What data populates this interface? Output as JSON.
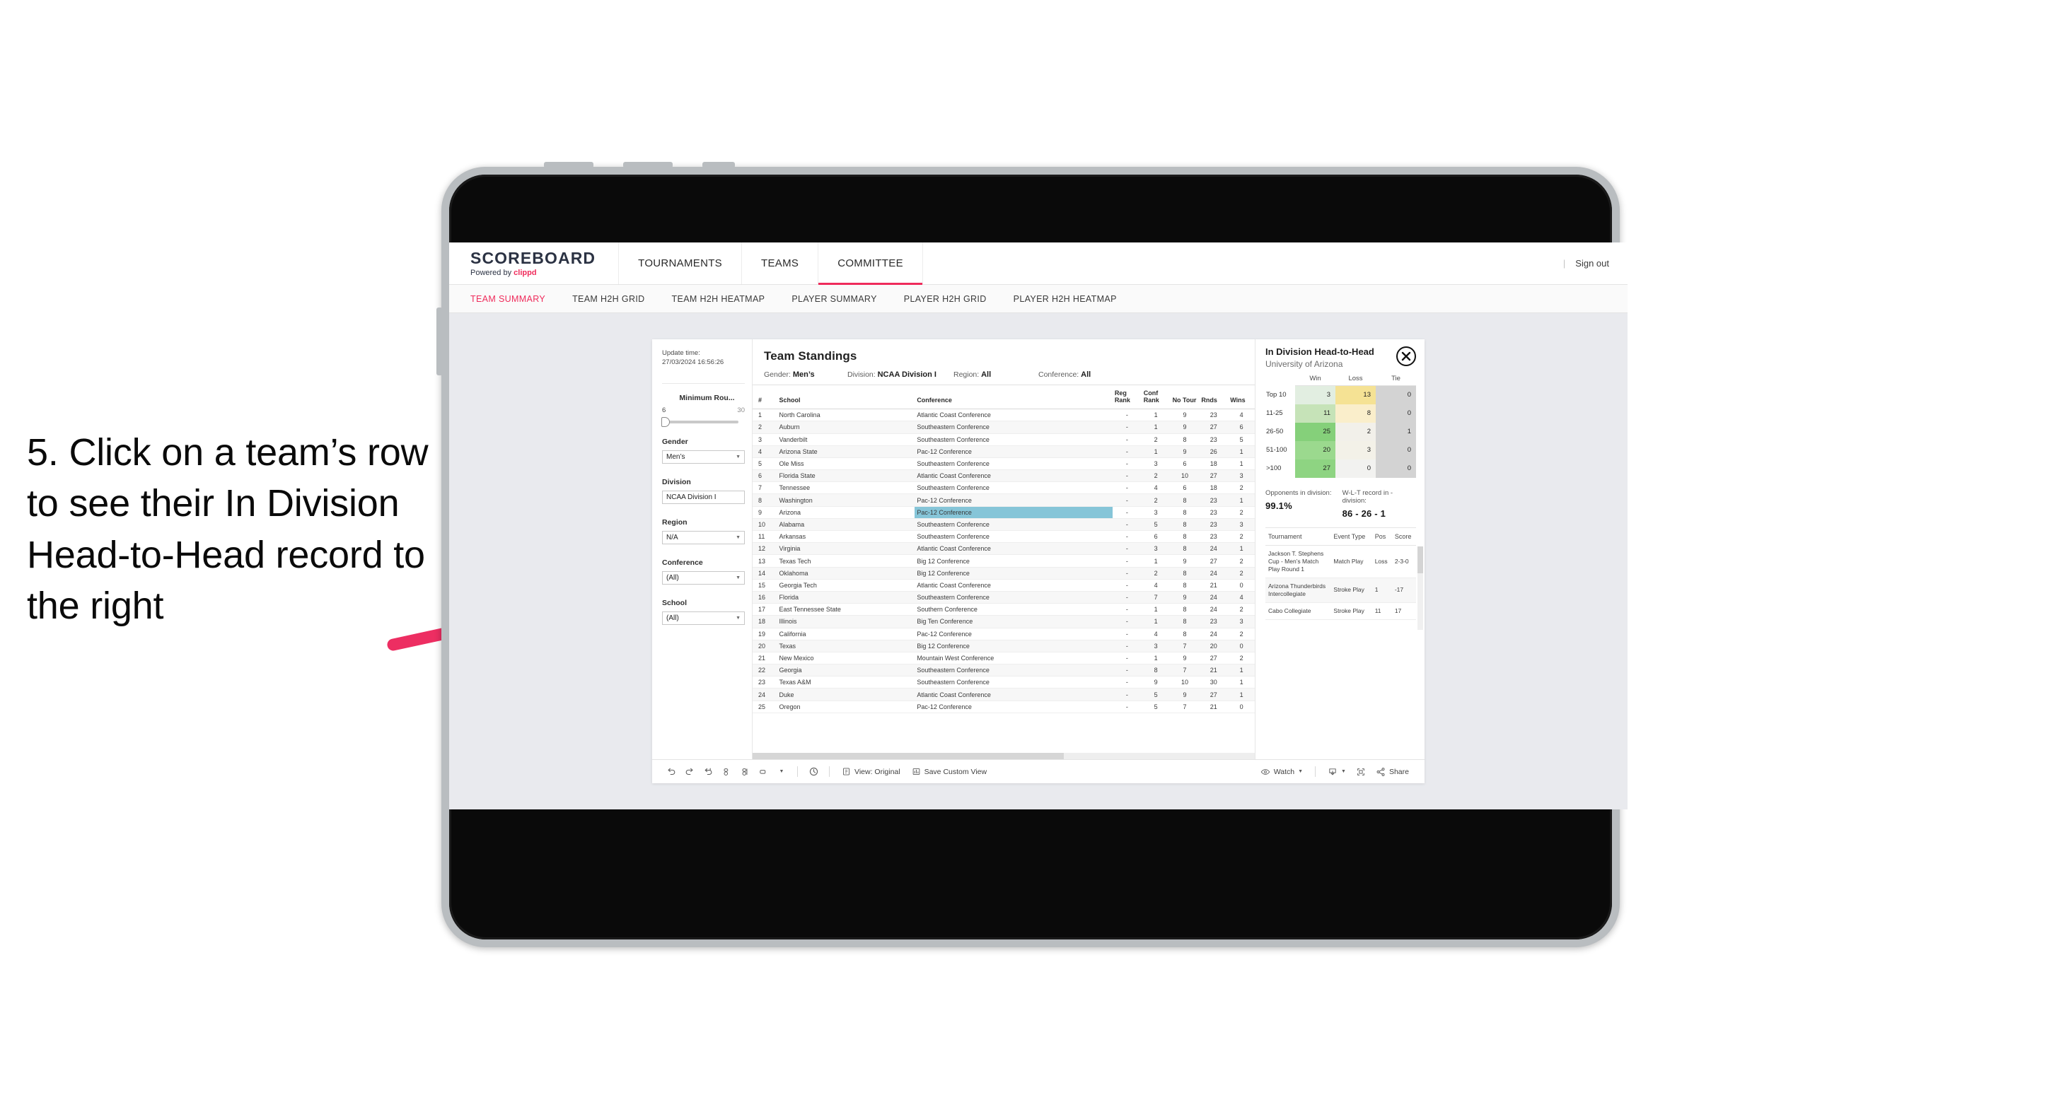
{
  "annotation": {
    "text": "5. Click on a team’s row to see their In Division Head-to-Head record to the right",
    "arrow_color": "#ed2e62"
  },
  "brand": {
    "title": "SCOREBOARD",
    "powered_prefix": "Powered by ",
    "powered_name": "clippd"
  },
  "topnav": {
    "items": [
      {
        "label": "TOURNAMENTS",
        "active": false
      },
      {
        "label": "TEAMS",
        "active": false
      },
      {
        "label": "COMMITTEE",
        "active": true
      }
    ],
    "sign_out": "Sign out",
    "divider": "|"
  },
  "subnav": {
    "items": [
      {
        "label": "TEAM SUMMARY",
        "active": true
      },
      {
        "label": "TEAM H2H GRID",
        "active": false
      },
      {
        "label": "TEAM H2H HEATMAP",
        "active": false
      },
      {
        "label": "PLAYER SUMMARY",
        "active": false
      },
      {
        "label": "PLAYER H2H GRID",
        "active": false
      },
      {
        "label": "PLAYER H2H HEATMAP",
        "active": false
      }
    ]
  },
  "filters": {
    "update_label": "Update time:",
    "update_value": "27/03/2024 16:56:26",
    "min_rounds": {
      "title": "Minimum Rou...",
      "min": "6",
      "max": "30",
      "value": 6
    },
    "gender": {
      "label": "Gender",
      "value": "Men’s"
    },
    "division": {
      "label": "Division",
      "value": "NCAA Division I"
    },
    "region": {
      "label": "Region",
      "value": "N/A"
    },
    "conference": {
      "label": "Conference",
      "value": "(All)"
    },
    "school": {
      "label": "School",
      "value": "(All)"
    }
  },
  "standings": {
    "title": "Team Standings",
    "meta": [
      {
        "label": "Gender: ",
        "value": "Men’s"
      },
      {
        "label": "Division: ",
        "value": "NCAA Division I"
      },
      {
        "label": "Region: ",
        "value": "All"
      },
      {
        "label": "Conference: ",
        "value": "All"
      }
    ],
    "columns": [
      "#",
      "School",
      "Conference",
      "Reg Rank",
      "Conf Rank",
      "No Tour",
      "Rnds",
      "Wins"
    ],
    "selected_row_index": 9,
    "rows": [
      {
        "n": "1",
        "school": "North Carolina",
        "conf": "Atlantic Coast Conference",
        "reg": "-",
        "cr": "1",
        "nt": "9",
        "rnds": "23",
        "wins": "4"
      },
      {
        "n": "2",
        "school": "Auburn",
        "conf": "Southeastern Conference",
        "reg": "-",
        "cr": "1",
        "nt": "9",
        "rnds": "27",
        "wins": "6"
      },
      {
        "n": "3",
        "school": "Vanderbilt",
        "conf": "Southeastern Conference",
        "reg": "-",
        "cr": "2",
        "nt": "8",
        "rnds": "23",
        "wins": "5"
      },
      {
        "n": "4",
        "school": "Arizona State",
        "conf": "Pac-12 Conference",
        "reg": "-",
        "cr": "1",
        "nt": "9",
        "rnds": "26",
        "wins": "1"
      },
      {
        "n": "5",
        "school": "Ole Miss",
        "conf": "Southeastern Conference",
        "reg": "-",
        "cr": "3",
        "nt": "6",
        "rnds": "18",
        "wins": "1"
      },
      {
        "n": "6",
        "school": "Florida State",
        "conf": "Atlantic Coast Conference",
        "reg": "-",
        "cr": "2",
        "nt": "10",
        "rnds": "27",
        "wins": "3"
      },
      {
        "n": "7",
        "school": "Tennessee",
        "conf": "Southeastern Conference",
        "reg": "-",
        "cr": "4",
        "nt": "6",
        "rnds": "18",
        "wins": "2"
      },
      {
        "n": "8",
        "school": "Washington",
        "conf": "Pac-12 Conference",
        "reg": "-",
        "cr": "2",
        "nt": "8",
        "rnds": "23",
        "wins": "1"
      },
      {
        "n": "9",
        "school": "Arizona",
        "conf": "Pac-12 Conference",
        "reg": "-",
        "cr": "3",
        "nt": "8",
        "rnds": "23",
        "wins": "2"
      },
      {
        "n": "10",
        "school": "Alabama",
        "conf": "Southeastern Conference",
        "reg": "-",
        "cr": "5",
        "nt": "8",
        "rnds": "23",
        "wins": "3"
      },
      {
        "n": "11",
        "school": "Arkansas",
        "conf": "Southeastern Conference",
        "reg": "-",
        "cr": "6",
        "nt": "8",
        "rnds": "23",
        "wins": "2"
      },
      {
        "n": "12",
        "school": "Virginia",
        "conf": "Atlantic Coast Conference",
        "reg": "-",
        "cr": "3",
        "nt": "8",
        "rnds": "24",
        "wins": "1"
      },
      {
        "n": "13",
        "school": "Texas Tech",
        "conf": "Big 12 Conference",
        "reg": "-",
        "cr": "1",
        "nt": "9",
        "rnds": "27",
        "wins": "2"
      },
      {
        "n": "14",
        "school": "Oklahoma",
        "conf": "Big 12 Conference",
        "reg": "-",
        "cr": "2",
        "nt": "8",
        "rnds": "24",
        "wins": "2"
      },
      {
        "n": "15",
        "school": "Georgia Tech",
        "conf": "Atlantic Coast Conference",
        "reg": "-",
        "cr": "4",
        "nt": "8",
        "rnds": "21",
        "wins": "0"
      },
      {
        "n": "16",
        "school": "Florida",
        "conf": "Southeastern Conference",
        "reg": "-",
        "cr": "7",
        "nt": "9",
        "rnds": "24",
        "wins": "4"
      },
      {
        "n": "17",
        "school": "East Tennessee State",
        "conf": "Southern Conference",
        "reg": "-",
        "cr": "1",
        "nt": "8",
        "rnds": "24",
        "wins": "2"
      },
      {
        "n": "18",
        "school": "Illinois",
        "conf": "Big Ten Conference",
        "reg": "-",
        "cr": "1",
        "nt": "8",
        "rnds": "23",
        "wins": "3"
      },
      {
        "n": "19",
        "school": "California",
        "conf": "Pac-12 Conference",
        "reg": "-",
        "cr": "4",
        "nt": "8",
        "rnds": "24",
        "wins": "2"
      },
      {
        "n": "20",
        "school": "Texas",
        "conf": "Big 12 Conference",
        "reg": "-",
        "cr": "3",
        "nt": "7",
        "rnds": "20",
        "wins": "0"
      },
      {
        "n": "21",
        "school": "New Mexico",
        "conf": "Mountain West Conference",
        "reg": "-",
        "cr": "1",
        "nt": "9",
        "rnds": "27",
        "wins": "2"
      },
      {
        "n": "22",
        "school": "Georgia",
        "conf": "Southeastern Conference",
        "reg": "-",
        "cr": "8",
        "nt": "7",
        "rnds": "21",
        "wins": "1"
      },
      {
        "n": "23",
        "school": "Texas A&M",
        "conf": "Southeastern Conference",
        "reg": "-",
        "cr": "9",
        "nt": "10",
        "rnds": "30",
        "wins": "1"
      },
      {
        "n": "24",
        "school": "Duke",
        "conf": "Atlantic Coast Conference",
        "reg": "-",
        "cr": "5",
        "nt": "9",
        "rnds": "27",
        "wins": "1"
      },
      {
        "n": "25",
        "school": "Oregon",
        "conf": "Pac-12 Conference",
        "reg": "-",
        "cr": "5",
        "nt": "7",
        "rnds": "21",
        "wins": "0"
      }
    ]
  },
  "detail": {
    "title": "In Division Head-to-Head",
    "subtitle": "University of Arizona",
    "close_icon": "close-icon",
    "h2h": {
      "columns": [
        "Win",
        "Loss",
        "Tie"
      ],
      "rows": [
        {
          "label": "Top 10",
          "win": "3",
          "loss": "13",
          "tie": "0",
          "win_color": "#e2eee1",
          "loss_color": "#f5e294",
          "tie_color": "#d3d3d3"
        },
        {
          "label": "11-25",
          "win": "11",
          "loss": "8",
          "tie": "0",
          "win_color": "#c6e3b8",
          "loss_color": "#faeecb",
          "tie_color": "#d3d3d3"
        },
        {
          "label": "26-50",
          "win": "25",
          "loss": "2",
          "tie": "1",
          "win_color": "#85d07a",
          "loss_color": "#f2f0ea",
          "tie_color": "#d3d3d3"
        },
        {
          "label": "51-100",
          "win": "20",
          "loss": "3",
          "tie": "0",
          "win_color": "#9bd98e",
          "loss_color": "#f3f1e8",
          "tie_color": "#d3d3d3"
        },
        {
          "label": ">100",
          "win": "27",
          "loss": "0",
          "tie": "0",
          "win_color": "#8ed482",
          "loss_color": "#f2f2f0",
          "tie_color": "#d3d3d3"
        }
      ]
    },
    "stats": [
      {
        "label": "Opponents in division:",
        "value": "99.1%"
      },
      {
        "label": "W-L-T record in -division:",
        "value": "86 - 26 - 1"
      }
    ],
    "tournaments": {
      "columns": [
        "Tournament",
        "Event Type",
        "Pos",
        "Score"
      ],
      "rows": [
        {
          "name": "Jackson T. Stephens Cup - Men’s Match Play Round 1",
          "type": "Match Play",
          "pos": "Loss",
          "score": "2-3-0"
        },
        {
          "name": "Arizona Thunderbirds Intercollegiate",
          "type": "Stroke Play",
          "pos": "1",
          "score": "-17"
        },
        {
          "name": "Cabo Collegiate",
          "type": "Stroke Play",
          "pos": "11",
          "score": "17"
        }
      ]
    }
  },
  "toolbar": {
    "icons": [
      "undo-icon",
      "redo-icon",
      "revert-icon",
      "refresh-icon",
      "pause-icon",
      "shape-icon",
      "history-icon"
    ],
    "view_label": "View: Original",
    "save_view_label": "Save Custom View",
    "watch_label": "Watch",
    "share_label": "Share",
    "download_icon": "download-icon",
    "fullscreen_icon": "fullscreen-icon",
    "share_icon": "share-icon"
  }
}
